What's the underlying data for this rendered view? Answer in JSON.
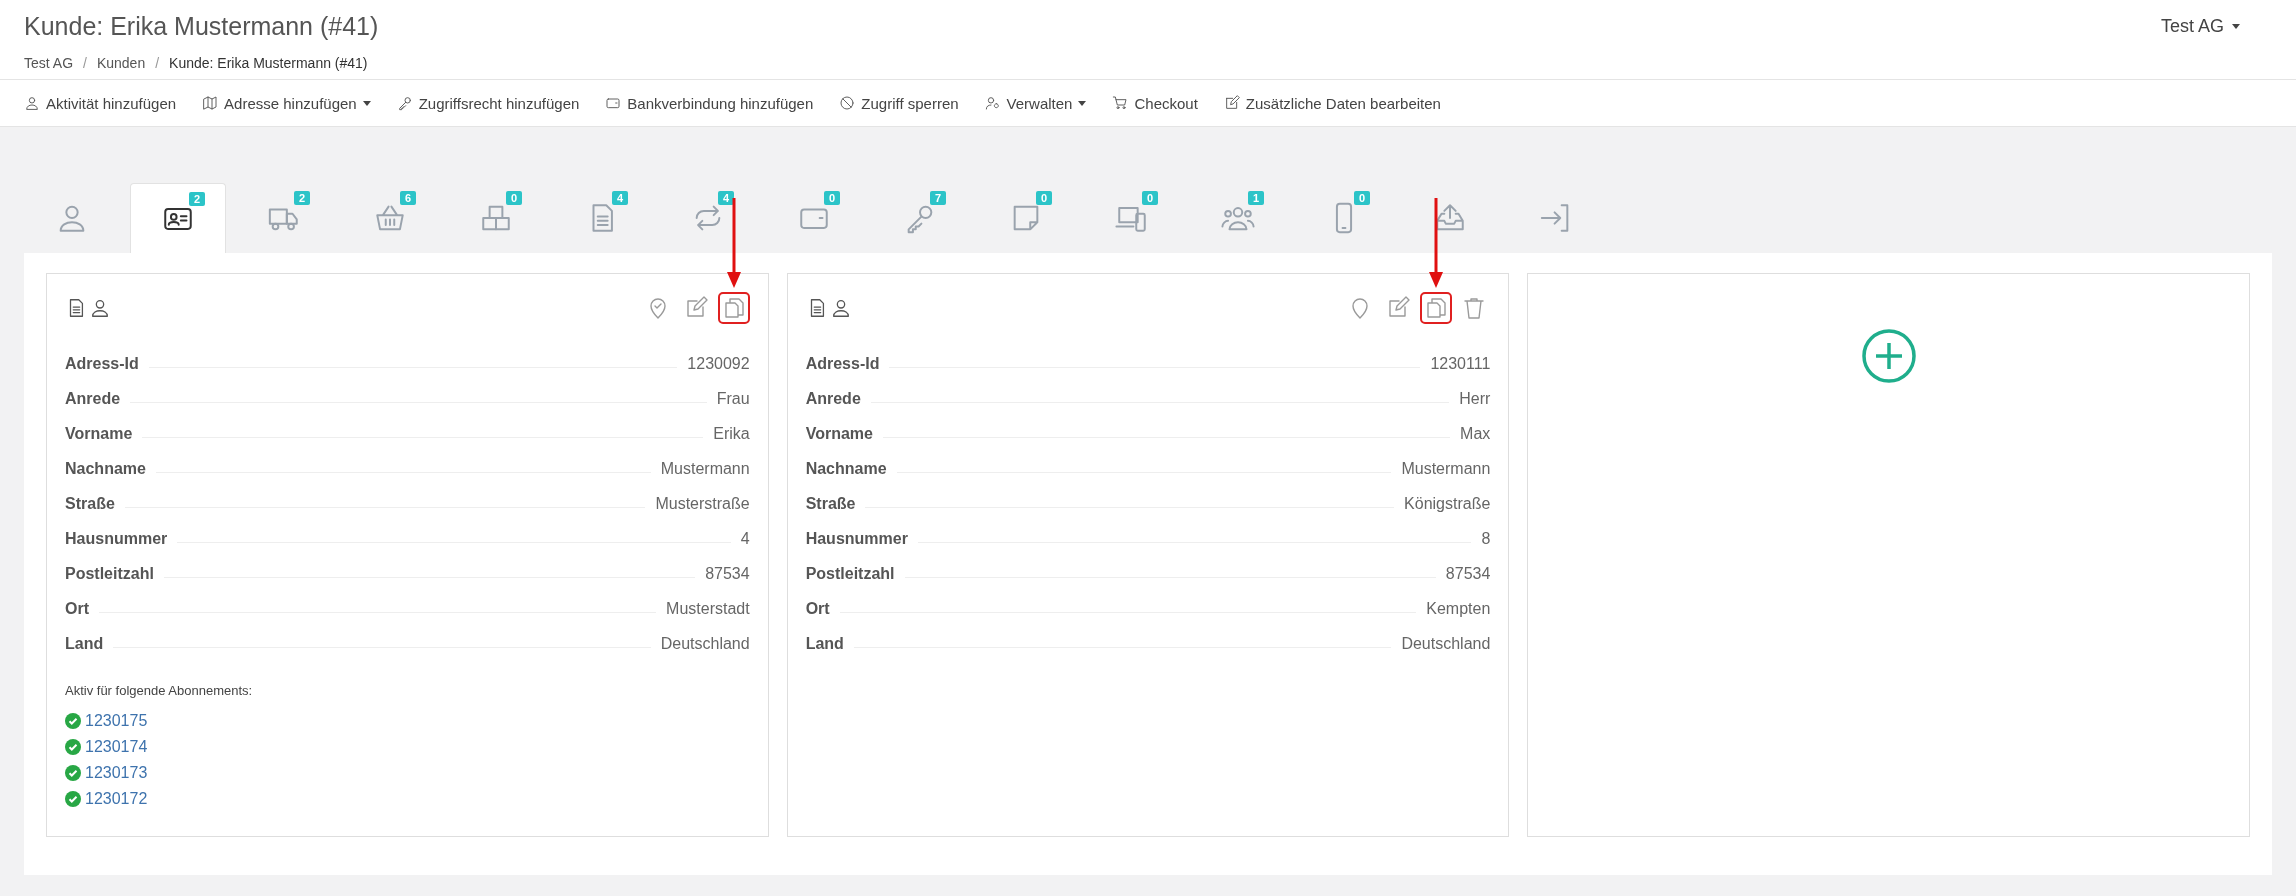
{
  "header": {
    "title": "Kunde: Erika Mustermann (#41)",
    "company_menu": "Test AG"
  },
  "breadcrumb": [
    {
      "label": "Test AG",
      "current": false,
      "separator": "/"
    },
    {
      "label": "Kunden",
      "current": false,
      "separator": "/"
    },
    {
      "label": "Kunde: Erika Mustermann (#41)",
      "current": true
    }
  ],
  "toolbar": [
    {
      "label": "Aktivität hinzufügen",
      "dropdown": false
    },
    {
      "label": "Adresse hinzufügen",
      "dropdown": true
    },
    {
      "label": "Zugriffsrecht hinzufügen",
      "dropdown": false
    },
    {
      "label": "Bankverbindung hinzufügen",
      "dropdown": false
    },
    {
      "label": "Zugriff sperren",
      "dropdown": false
    },
    {
      "label": "Verwalten",
      "dropdown": true
    },
    {
      "label": "Checkout",
      "dropdown": false
    },
    {
      "label": "Zusätzliche Daten bearbeiten",
      "dropdown": false
    }
  ],
  "tabs": [
    {
      "selected": false
    },
    {
      "selected": true,
      "badge": "2"
    },
    {
      "selected": false,
      "badge": "2"
    },
    {
      "selected": false,
      "badge": "6"
    },
    {
      "selected": false,
      "badge": "0"
    },
    {
      "selected": false,
      "badge": "4"
    },
    {
      "selected": false,
      "badge": "4"
    },
    {
      "selected": false,
      "badge": "0"
    },
    {
      "selected": false,
      "badge": "7"
    },
    {
      "selected": false,
      "badge": "0"
    },
    {
      "selected": false,
      "badge": "0"
    },
    {
      "selected": false,
      "badge": "1"
    },
    {
      "selected": false,
      "badge": "0"
    },
    {
      "selected": false
    },
    {
      "selected": false
    }
  ],
  "cards": [
    {
      "kind": "address",
      "actions": [
        {
          "kind": "marked",
          "highlighted": false
        },
        {
          "kind": "edit",
          "highlighted": false
        },
        {
          "kind": "copy",
          "highlighted": true
        }
      ],
      "fields": [
        {
          "label": "Adress-Id",
          "value": "1230092"
        },
        {
          "label": "Anrede",
          "value": "Frau"
        },
        {
          "label": "Vorname",
          "value": "Erika"
        },
        {
          "label": "Nachname",
          "value": "Mustermann"
        },
        {
          "label": "Straße",
          "value": "Musterstraße"
        },
        {
          "label": "Hausnummer",
          "value": "4"
        },
        {
          "label": "Postleitzahl",
          "value": "87534"
        },
        {
          "label": "Ort",
          "value": "Musterstadt"
        },
        {
          "label": "Land",
          "value": "Deutschland"
        }
      ],
      "subscriptions_heading": "Aktiv für folgende Abonnements:",
      "subscriptions": [
        {
          "id": "1230175",
          "active": true
        },
        {
          "id": "1230174",
          "active": true
        },
        {
          "id": "1230173",
          "active": true
        },
        {
          "id": "1230172",
          "active": true
        }
      ]
    },
    {
      "kind": "address",
      "actions": [
        {
          "kind": "locate",
          "highlighted": false
        },
        {
          "kind": "edit",
          "highlighted": false
        },
        {
          "kind": "copy",
          "highlighted": true
        },
        {
          "kind": "delete",
          "highlighted": false
        }
      ],
      "fields": [
        {
          "label": "Adress-Id",
          "value": "1230111"
        },
        {
          "label": "Anrede",
          "value": "Herr"
        },
        {
          "label": "Vorname",
          "value": "Max"
        },
        {
          "label": "Nachname",
          "value": "Mustermann"
        },
        {
          "label": "Straße",
          "value": "Königstraße"
        },
        {
          "label": "Hausnummer",
          "value": "8"
        },
        {
          "label": "Postleitzahl",
          "value": "87534"
        },
        {
          "label": "Ort",
          "value": "Kempten"
        },
        {
          "label": "Land",
          "value": "Deutschland"
        }
      ]
    },
    {
      "kind": "add"
    }
  ]
}
